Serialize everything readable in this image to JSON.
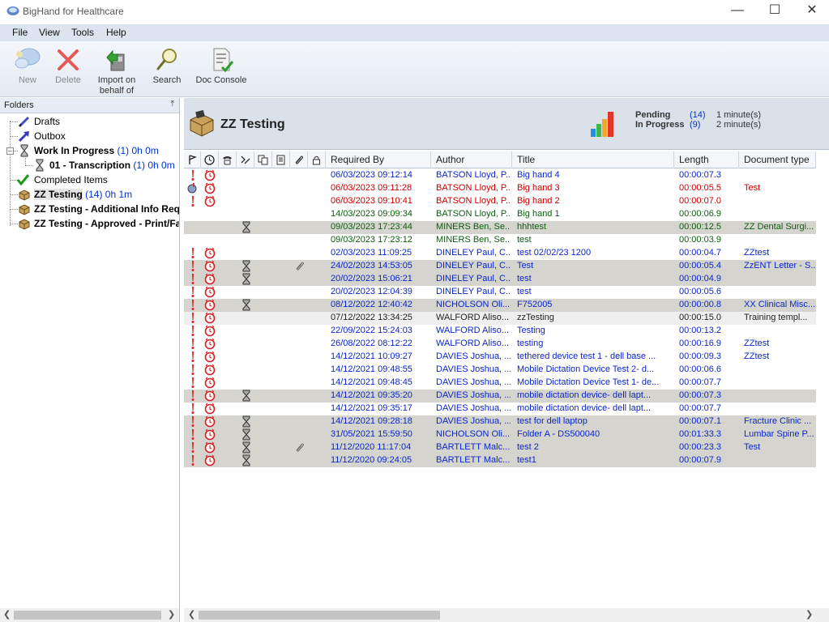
{
  "window": {
    "title": "BigHand for Healthcare"
  },
  "menu": [
    "File",
    "View",
    "Tools",
    "Help"
  ],
  "toolbar": {
    "new": "New",
    "delete": "Delete",
    "import_line1": "Import on",
    "import_line2": "behalf of",
    "search": "Search",
    "doc_console": "Doc Console"
  },
  "folders_pane": {
    "title": "Folders"
  },
  "tree": {
    "drafts": "Drafts",
    "outbox": "Outbox",
    "wip": "Work In Progress",
    "wip_count": "(1) 0h 0m",
    "transcription": "01 - Transcription",
    "transcription_count": "(1) 0h 0m",
    "completed": "Completed Items",
    "zz_testing": "ZZ Testing",
    "zz_testing_count": "(14) 0h 1m",
    "zz_additional": "ZZ Testing - Additional Info Req'd",
    "zz_approved": "ZZ Testing - Approved - Print/Fail"
  },
  "folder_header": {
    "title": "ZZ Testing",
    "pending_label": "Pending",
    "pending_count": "(14)",
    "pending_time": "1 minute(s)",
    "in_progress_label": "In Progress",
    "in_progress_count": "(9)",
    "in_progress_time": "2 minute(s)"
  },
  "columns": {
    "required_by": "Required By",
    "author": "Author",
    "title": "Title",
    "length": "Length",
    "doc_type": "Document type"
  },
  "rows": [
    {
      "shade": "",
      "color": "blue",
      "flag": "excl",
      "timer": true,
      "hour": false,
      "clip": false,
      "date": "06/03/2023 09:12:14",
      "author": "BATSON Lloyd, P...",
      "title": "Big hand 4",
      "length": "00:00:07.3",
      "doctype": ""
    },
    {
      "shade": "",
      "color": "red",
      "flag": "priority",
      "timer": true,
      "hour": false,
      "clip": false,
      "date": "06/03/2023 09:11:28",
      "author": "BATSON Lloyd, P...",
      "title": "Big hand 3",
      "length": "00:00:05.5",
      "doctype": "Test"
    },
    {
      "shade": "",
      "color": "red",
      "flag": "excl",
      "timer": true,
      "hour": false,
      "clip": false,
      "date": "06/03/2023 09:10:41",
      "author": "BATSON Lloyd, P...",
      "title": "Big hand 2",
      "length": "00:00:07.0",
      "doctype": ""
    },
    {
      "shade": "",
      "color": "green",
      "flag": "",
      "timer": false,
      "hour": false,
      "clip": false,
      "date": "14/03/2023 09:09:34",
      "author": "BATSON Lloyd, P...",
      "title": "Big hand 1",
      "length": "00:00:06.9",
      "doctype": ""
    },
    {
      "shade": "shaded",
      "color": "green",
      "flag": "",
      "timer": false,
      "hour": true,
      "clip": false,
      "date": "09/03/2023 17:23:44",
      "author": "MINERS Ben, Se...",
      "title": "hhhtest",
      "length": "00:00:12.5",
      "doctype": "ZZ Dental Surgi..."
    },
    {
      "shade": "",
      "color": "green",
      "flag": "",
      "timer": false,
      "hour": false,
      "clip": false,
      "date": "09/03/2023 17:23:12",
      "author": "MINERS Ben, Se...",
      "title": "test",
      "length": "00:00:03.9",
      "doctype": ""
    },
    {
      "shade": "",
      "color": "blue",
      "flag": "excl",
      "timer": true,
      "hour": false,
      "clip": false,
      "date": "02/03/2023 11:09:25",
      "author": "DINELEY Paul, C...",
      "title": "test 02/02/23 1200",
      "length": "00:00:04.7",
      "doctype": "ZZtest"
    },
    {
      "shade": "shaded",
      "color": "blue",
      "flag": "excl",
      "timer": true,
      "hour": true,
      "clip": true,
      "date": "24/02/2023 14:53:05",
      "author": "DINELEY Paul, C...",
      "title": "Test",
      "length": "00:00:05.4",
      "doctype": "ZzENT Letter - S..."
    },
    {
      "shade": "shaded",
      "color": "blue",
      "flag": "excl",
      "timer": true,
      "hour": true,
      "clip": false,
      "date": "20/02/2023 15:06:21",
      "author": "DINELEY Paul, C...",
      "title": "test",
      "length": "00:00:04.9",
      "doctype": ""
    },
    {
      "shade": "",
      "color": "blue",
      "flag": "excl",
      "timer": true,
      "hour": false,
      "clip": false,
      "date": "20/02/2023 12:04:39",
      "author": "DINELEY Paul, C...",
      "title": "test",
      "length": "00:00:05.6",
      "doctype": ""
    },
    {
      "shade": "shaded",
      "color": "blue",
      "flag": "excl",
      "timer": true,
      "hour": true,
      "clip": false,
      "date": "08/12/2022 12:40:42",
      "author": "NICHOLSON Oli...",
      "title": "F752005",
      "length": "00:00:00.8",
      "doctype": "XX Clinical Misc..."
    },
    {
      "shade": "light",
      "color": "black",
      "flag": "excl",
      "timer": true,
      "hour": false,
      "clip": false,
      "date": "07/12/2022 13:34:25",
      "author": "WALFORD Aliso...",
      "title": "zzTesting",
      "length": "00:00:15.0",
      "doctype": "Training templ..."
    },
    {
      "shade": "",
      "color": "blue",
      "flag": "excl",
      "timer": true,
      "hour": false,
      "clip": false,
      "date": "22/09/2022 15:24:03",
      "author": "WALFORD Aliso...",
      "title": "Testing",
      "length": "00:00:13.2",
      "doctype": ""
    },
    {
      "shade": "",
      "color": "blue",
      "flag": "excl",
      "timer": true,
      "hour": false,
      "clip": false,
      "date": "26/08/2022 08:12:22",
      "author": "WALFORD Aliso...",
      "title": "testing",
      "length": "00:00:16.9",
      "doctype": "ZZtest"
    },
    {
      "shade": "",
      "color": "blue",
      "flag": "excl",
      "timer": true,
      "hour": false,
      "clip": false,
      "date": "14/12/2021 10:09:27",
      "author": "DAVIES Joshua, ...",
      "title": "tethered device test 1 - dell base ...",
      "length": "00:00:09.3",
      "doctype": "ZZtest"
    },
    {
      "shade": "",
      "color": "blue",
      "flag": "excl",
      "timer": true,
      "hour": false,
      "clip": false,
      "date": "14/12/2021 09:48:55",
      "author": "DAVIES Joshua, ...",
      "title": "Mobile Dictation Device Test 2- d...",
      "length": "00:00:06.6",
      "doctype": ""
    },
    {
      "shade": "",
      "color": "blue",
      "flag": "excl",
      "timer": true,
      "hour": false,
      "clip": false,
      "date": "14/12/2021 09:48:45",
      "author": "DAVIES Joshua, ...",
      "title": "Mobile Dictation Device Test 1- de...",
      "length": "00:00:07.7",
      "doctype": ""
    },
    {
      "shade": "shaded",
      "color": "blue",
      "flag": "excl",
      "timer": true,
      "hour": true,
      "clip": false,
      "date": "14/12/2021 09:35:20",
      "author": "DAVIES Joshua, ...",
      "title": "mobile dictation device- dell lapt...",
      "length": "00:00:07.3",
      "doctype": ""
    },
    {
      "shade": "",
      "color": "blue",
      "flag": "excl",
      "timer": true,
      "hour": false,
      "clip": false,
      "date": "14/12/2021 09:35:17",
      "author": "DAVIES Joshua, ...",
      "title": "mobile dictation device- dell lapt...",
      "length": "00:00:07.7",
      "doctype": ""
    },
    {
      "shade": "shaded",
      "color": "blue",
      "flag": "excl",
      "timer": true,
      "hour": true,
      "clip": false,
      "date": "14/12/2021 09:28:18",
      "author": "DAVIES Joshua, ...",
      "title": "test for dell laptop",
      "length": "00:00:07.1",
      "doctype": "Fracture Clinic ..."
    },
    {
      "shade": "shaded",
      "color": "blue",
      "flag": "excl",
      "timer": true,
      "hour": true,
      "clip": false,
      "date": "31/05/2021 15:59:50",
      "author": "NICHOLSON Oli...",
      "title": "Folder A - DS500040",
      "length": "00:01:33.3",
      "doctype": "Lumbar Spine P..."
    },
    {
      "shade": "shaded",
      "color": "blue",
      "flag": "excl",
      "timer": true,
      "hour": true,
      "clip": true,
      "date": "11/12/2020 11:17:04",
      "author": "BARTLETT Malc...",
      "title": "test 2",
      "length": "00:00:23.3",
      "doctype": "Test"
    },
    {
      "shade": "shaded",
      "color": "blue",
      "flag": "excl",
      "timer": true,
      "hour": true,
      "clip": false,
      "date": "11/12/2020 09:24:05",
      "author": "BARTLETT Malc...",
      "title": "test1",
      "length": "00:00:07.9",
      "doctype": ""
    }
  ]
}
